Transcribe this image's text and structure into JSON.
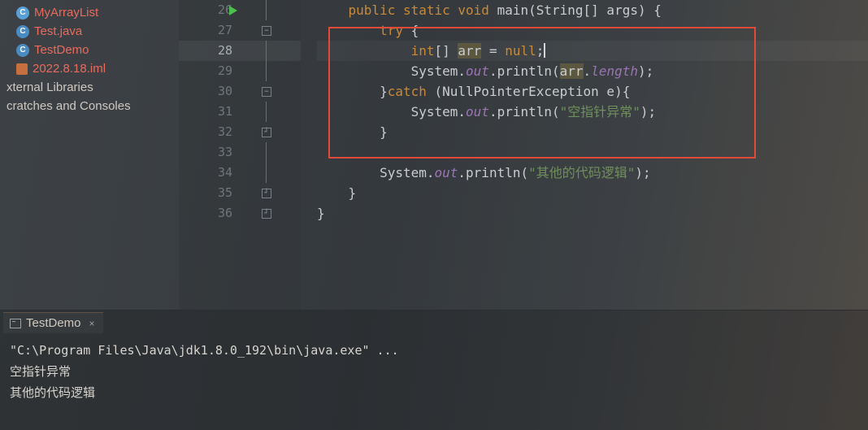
{
  "sidebar": {
    "items": [
      {
        "icon": "class-c",
        "label": "MyArrayList",
        "cls": "file-red"
      },
      {
        "icon": "class-c",
        "label": "Test.java",
        "cls": "file-red"
      },
      {
        "icon": "class-c",
        "label": "TestDemo",
        "cls": "file-red"
      },
      {
        "icon": "iml",
        "label": "2022.8.18.iml",
        "cls": "file-red"
      }
    ],
    "ext_lib": "xternal Libraries",
    "scratch": "cratches and Consoles"
  },
  "gutter": {
    "lines": [
      "26",
      "27",
      "28",
      "29",
      "30",
      "31",
      "32",
      "33",
      "34",
      "35",
      "36"
    ],
    "current": "28"
  },
  "code": {
    "l26_public": "public",
    "l26_static": "static",
    "l26_void": "void",
    "l26_rest": " main(String[] args) {",
    "l27_try": "try",
    "l27_rest": " {",
    "l28_int": "int",
    "l28_mid": "[] ",
    "l28_arr": "arr",
    "l28_eq": " = ",
    "l28_null": "null",
    "l28_semi": ";",
    "l29_a": "            System.",
    "l29_out": "out",
    "l29_b": ".println(",
    "l29_arr": "arr",
    "l29_c": ".",
    "l29_len": "length",
    "l29_d": ");",
    "l30_a": "        }",
    "l30_catch": "catch",
    "l30_b": " (NullPointerException e){",
    "l31_a": "            System.",
    "l31_out": "out",
    "l31_b": ".println(",
    "l31_str": "\"空指针异常\"",
    "l31_c": ");",
    "l32": "        }",
    "l33": "",
    "l34_a": "        System.",
    "l34_out": "out",
    "l34_b": ".println(",
    "l34_str": "\"其他的代码逻辑\"",
    "l34_c": ");",
    "l35": "    }",
    "l36": "}"
  },
  "console": {
    "tab": "TestDemo",
    "line1": "\"C:\\Program Files\\Java\\jdk1.8.0_192\\bin\\java.exe\" ...",
    "line2": "空指针异常",
    "line3": "其他的代码逻辑"
  }
}
